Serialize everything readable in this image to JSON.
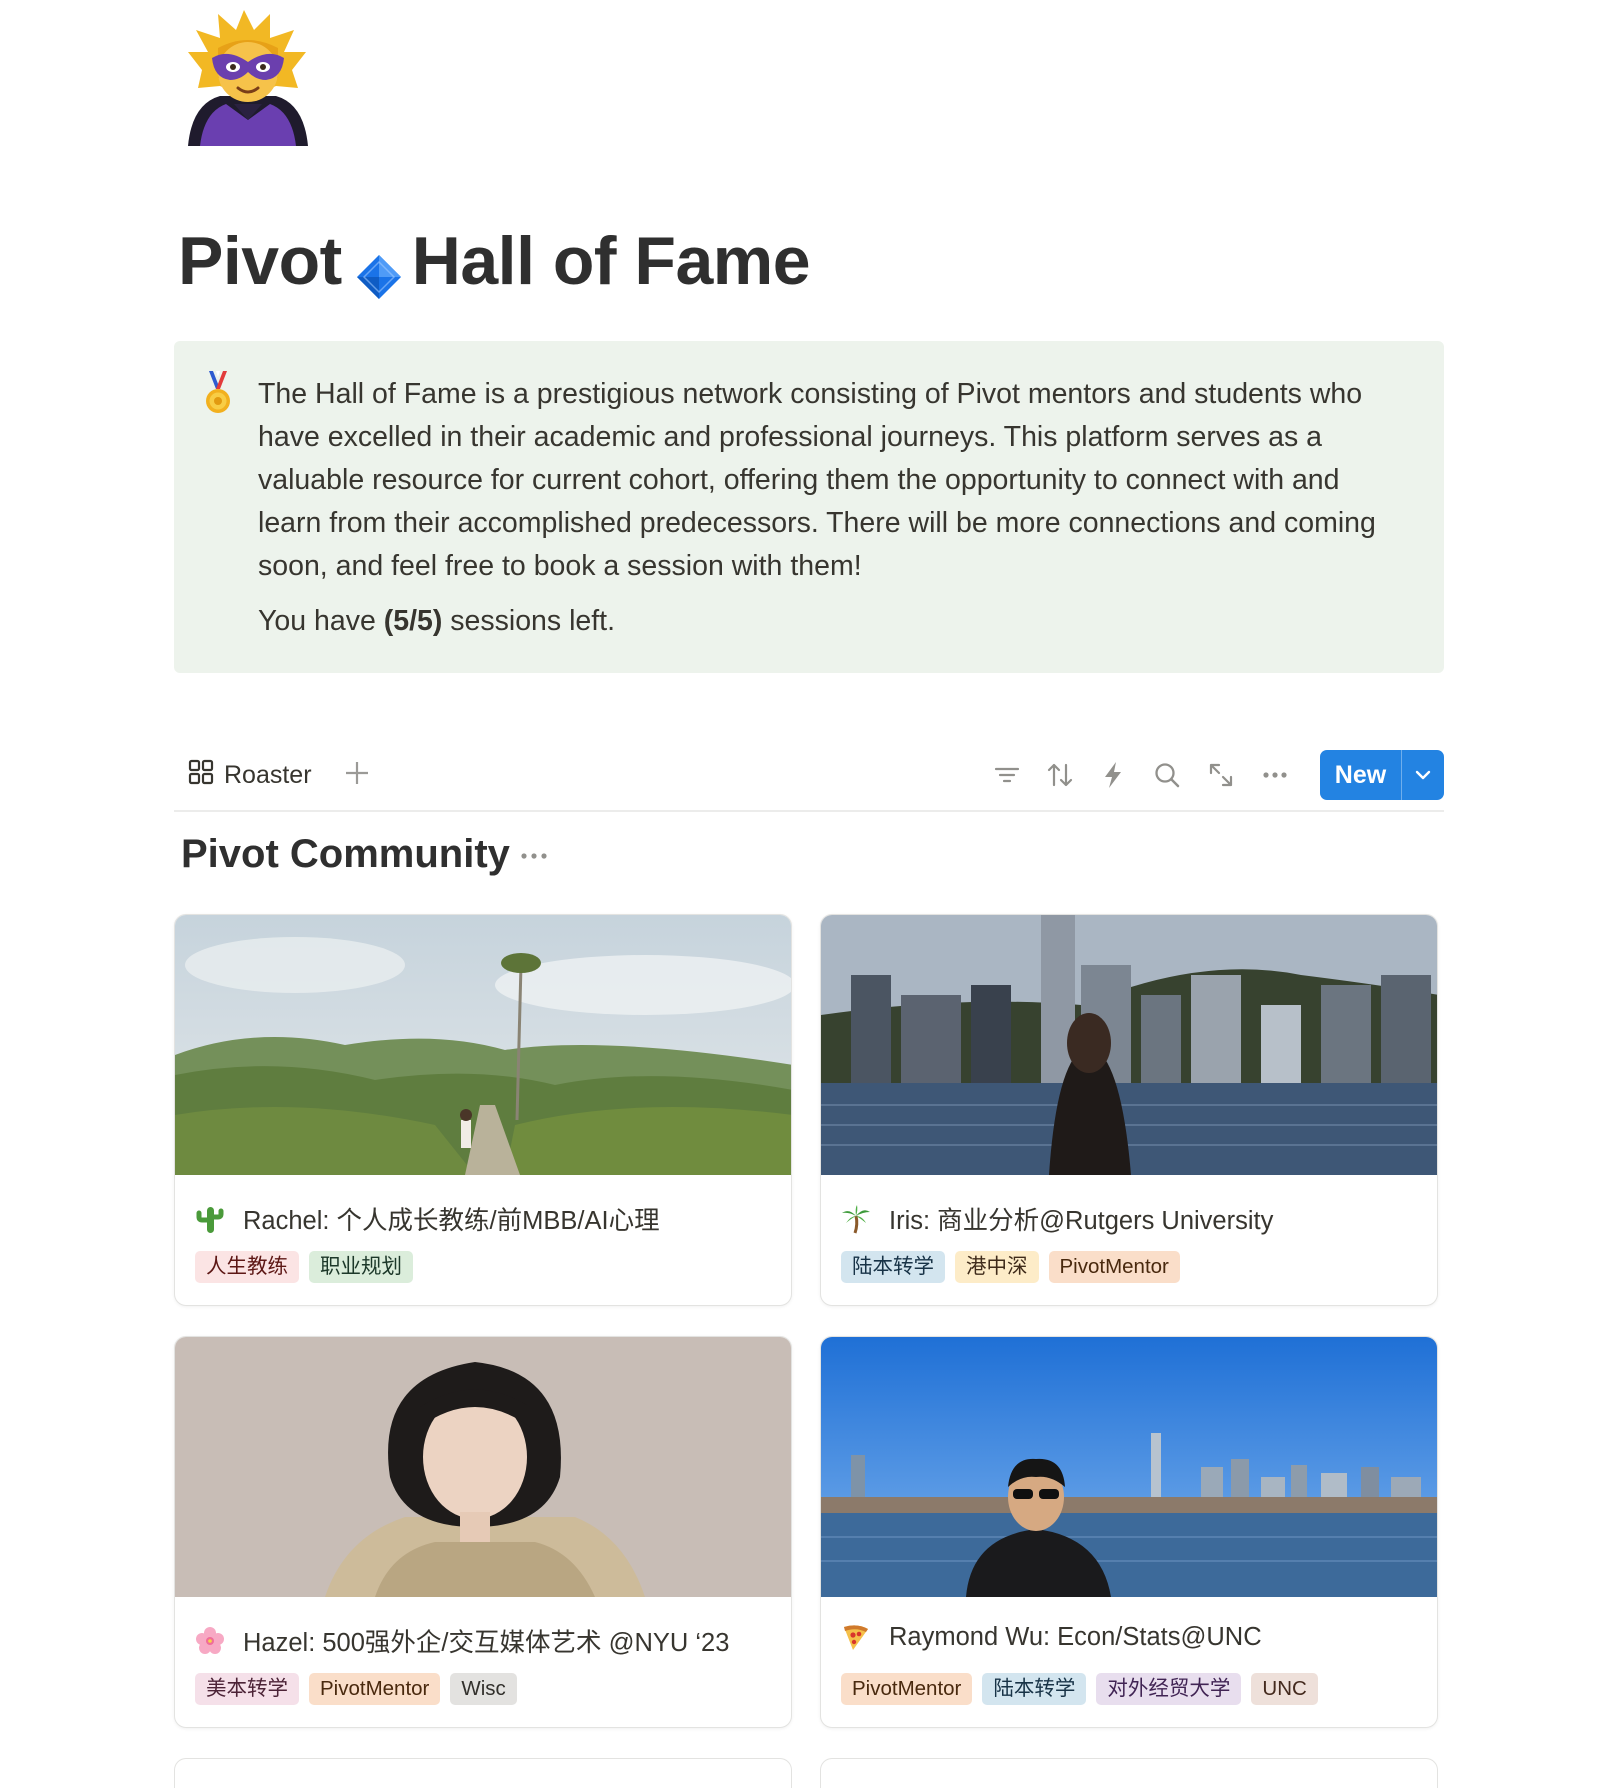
{
  "page": {
    "icon": "superhero-emoji-icon",
    "title_part1": "Pivot",
    "title_part2": "Hall of Fame",
    "title_diamond_icon": "blue-diamond-icon"
  },
  "callout": {
    "icon": "medal-icon",
    "paragraph": "The Hall of Fame is a prestigious network consisting of Pivot mentors and students who have excelled in their academic and professional journeys. This platform serves as a valuable resource for current cohort, offering them the opportunity to connect with and learn from their accomplished predecessors. There will be more connections and coming soon, and feel free to book a session with them!",
    "sessions_prefix": "You have ",
    "sessions_count": "(5/5)",
    "sessions_suffix": " sessions left."
  },
  "toolbar": {
    "view_label": "Roaster",
    "view_icon": "gallery-grid-icon",
    "new_label": "New",
    "icons": [
      "filter-icon",
      "sort-icon",
      "automation-bolt-icon",
      "search-icon",
      "expand-icon",
      "more-icon"
    ]
  },
  "group": {
    "title": "Pivot Community"
  },
  "cards": [
    {
      "emoji": "cactus-icon",
      "title": "Rachel: 个人成长教练/前MBB/AI心理",
      "tags": [
        {
          "label": "人生教练",
          "color": "red"
        },
        {
          "label": "职业规划",
          "color": "green"
        }
      ]
    },
    {
      "emoji": "palm-tree-icon",
      "title": "Iris: 商业分析@Rutgers University",
      "tags": [
        {
          "label": "陆本转学",
          "color": "blue"
        },
        {
          "label": "港中深",
          "color": "yellow"
        },
        {
          "label": "PivotMentor",
          "color": "orange"
        }
      ]
    },
    {
      "emoji": "cherry-blossom-icon",
      "title": "Hazel: 500强外企/交互媒体艺术 @NYU ‘23",
      "tags": [
        {
          "label": "美本转学",
          "color": "pink"
        },
        {
          "label": "PivotMentor",
          "color": "orange"
        },
        {
          "label": "Wisc",
          "color": "gray"
        }
      ]
    },
    {
      "emoji": "pizza-icon",
      "title": "Raymond Wu: Econ/Stats@UNC",
      "tags": [
        {
          "label": "PivotMentor",
          "color": "orange"
        },
        {
          "label": "陆本转学",
          "color": "blue"
        },
        {
          "label": "对外经贸大学",
          "color": "purple"
        },
        {
          "label": "UNC",
          "color": "brown"
        }
      ]
    }
  ],
  "colors": {
    "accent": "#2383e2",
    "callout_bg": "#edf3ec",
    "text": "#37352f"
  }
}
